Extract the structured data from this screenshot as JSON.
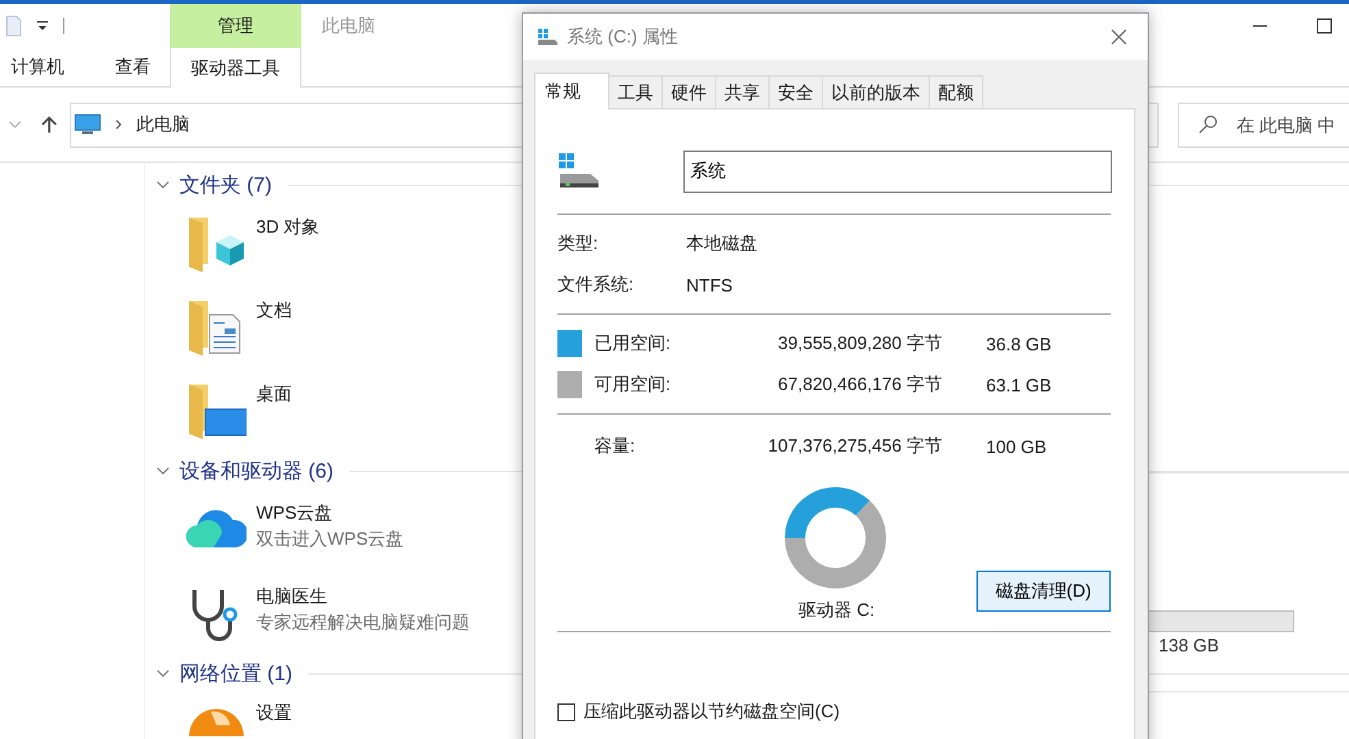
{
  "explorer": {
    "title": "此电脑",
    "ribbon_tabs": [
      {
        "label": "计算机",
        "selected": false
      },
      {
        "label": "查看",
        "selected": false
      },
      {
        "label": "驱动器工具",
        "group": "管理",
        "selected": true
      }
    ],
    "address": {
      "path": "此电脑"
    },
    "search": {
      "placeholder": "在 此电脑 中"
    },
    "groups": [
      {
        "title": "文件夹 (7)",
        "expanded": true,
        "items": [
          {
            "name": "3D 对象",
            "kind": "folder3d"
          },
          {
            "name": "文档",
            "kind": "folderdoc"
          },
          {
            "name": "桌面",
            "kind": "folderdesktop"
          }
        ]
      },
      {
        "title": "设备和驱动器 (6)",
        "expanded": true,
        "items": [
          {
            "name": "WPS云盘",
            "detail": "双击进入WPS云盘",
            "kind": "cloud"
          },
          {
            "name": "电脑医生",
            "detail": "专家远程解决电脑疑难问题",
            "kind": "stethoscope"
          }
        ]
      },
      {
        "title": "网络位置 (1)",
        "expanded": true,
        "items": [
          {
            "name": "设置",
            "kind": "globe"
          }
        ]
      }
    ],
    "partial_drive": {
      "free": "138 GB"
    }
  },
  "dialog": {
    "title": "系统 (C:) 属性",
    "tabs": [
      {
        "label": "常规",
        "selected": true
      },
      {
        "label": "工具",
        "selected": false
      },
      {
        "label": "硬件",
        "selected": false
      },
      {
        "label": "共享",
        "selected": false
      },
      {
        "label": "安全",
        "selected": false
      },
      {
        "label": "以前的版本",
        "selected": false
      },
      {
        "label": "配额",
        "selected": false
      }
    ],
    "volume_name": "系统",
    "type_label": "类型:",
    "type_value": "本地磁盘",
    "fs_label": "文件系统:",
    "fs_value": "NTFS",
    "space": [
      {
        "label": "已用空间:",
        "bytes": "39,555,809,280 字节",
        "size": "36.8 GB",
        "color": "#26a0da"
      },
      {
        "label": "可用空间:",
        "bytes": "67,820,466,176 字节",
        "size": "63.1 GB",
        "color": "#adadad"
      }
    ],
    "capacity": {
      "label": "容量:",
      "bytes": "107,376,275,456 字节",
      "size": "100 GB"
    },
    "usage_ring": {
      "chart_data": {
        "type": "donut",
        "values": [
          36.8,
          63.1
        ]
      }
    },
    "drive_label": "驱动器 C:",
    "cleanup_button": "磁盘清理(D)",
    "compress": {
      "label": "压缩此驱动器以节约磁盘空间(C)",
      "checked": false
    }
  }
}
